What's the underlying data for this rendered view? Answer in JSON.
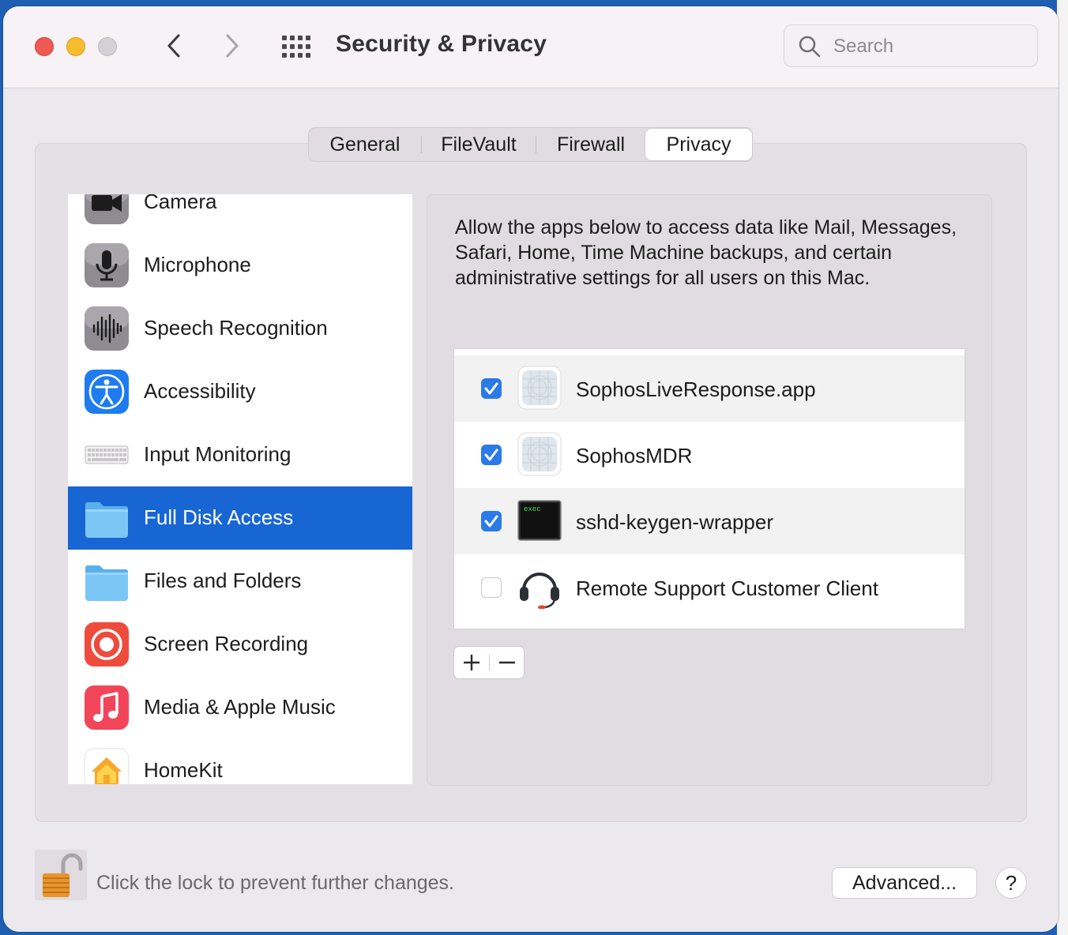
{
  "window": {
    "title": "Security & Privacy",
    "search_placeholder": "Search"
  },
  "tabs": [
    {
      "label": "General",
      "active": false
    },
    {
      "label": "FileVault",
      "active": false
    },
    {
      "label": "Firewall",
      "active": false
    },
    {
      "label": "Privacy",
      "active": true
    }
  ],
  "sidebar": {
    "items": [
      {
        "label": "Camera",
        "icon": "camera-icon",
        "selected": false
      },
      {
        "label": "Microphone",
        "icon": "microphone-icon",
        "selected": false
      },
      {
        "label": "Speech Recognition",
        "icon": "waveform-icon",
        "selected": false
      },
      {
        "label": "Accessibility",
        "icon": "accessibility-icon",
        "selected": false
      },
      {
        "label": "Input Monitoring",
        "icon": "keyboard-icon",
        "selected": false
      },
      {
        "label": "Full Disk Access",
        "icon": "folder-icon",
        "selected": true
      },
      {
        "label": "Files and Folders",
        "icon": "folder-icon",
        "selected": false
      },
      {
        "label": "Screen Recording",
        "icon": "screen-recording-icon",
        "selected": false
      },
      {
        "label": "Media & Apple Music",
        "icon": "music-note-icon",
        "selected": false
      },
      {
        "label": "HomeKit",
        "icon": "home-icon",
        "selected": false
      }
    ]
  },
  "panel": {
    "description": "Allow the apps below to access data like Mail, Messages, Safari, Home, Time Machine backups, and certain administrative settings for all users on this Mac.",
    "apps": [
      {
        "name": "SophosLiveResponse.app",
        "checked": true,
        "icon": "generic-app-icon"
      },
      {
        "name": "SophosMDR",
        "checked": true,
        "icon": "generic-app-icon"
      },
      {
        "name": "sshd-keygen-wrapper",
        "checked": true,
        "icon": "terminal-exec-icon",
        "icon_text": "exec"
      },
      {
        "name": "Remote Support Customer Client",
        "checked": false,
        "icon": "headset-icon"
      }
    ]
  },
  "footer": {
    "lock_text": "Click the lock to prevent further changes.",
    "advanced_label": "Advanced...",
    "help_label": "?"
  },
  "colors": {
    "selection_blue": "#1766d4",
    "checkbox_blue": "#2a7ae8",
    "close_red": "#ee5a52",
    "minimize_yellow": "#f5bd2f"
  }
}
